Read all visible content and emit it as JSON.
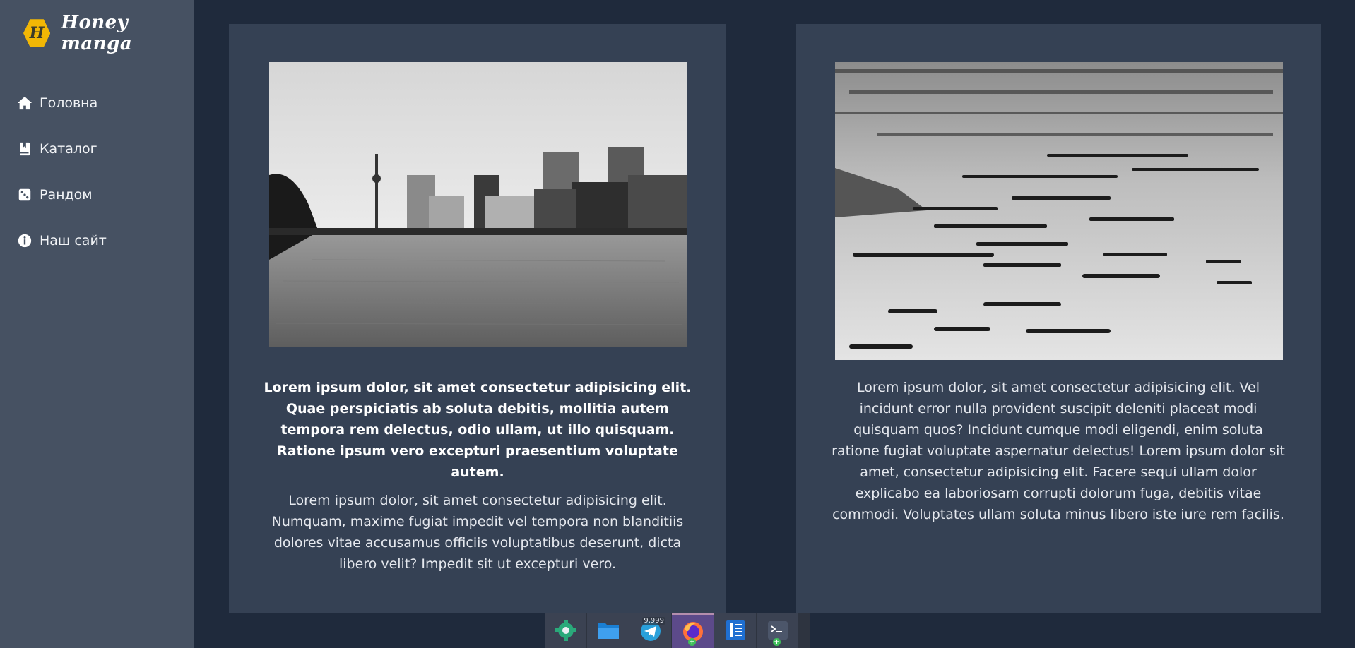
{
  "brand": {
    "logo_letter": "H",
    "name": "Honey manga",
    "logo_color": "#f2b705"
  },
  "sidebar": {
    "items": [
      {
        "label": "Головна",
        "icon": "home-icon"
      },
      {
        "label": "Каталог",
        "icon": "book-icon"
      },
      {
        "label": "Рандом",
        "icon": "dice-icon"
      },
      {
        "label": "Наш сайт",
        "icon": "info-icon"
      }
    ]
  },
  "cards": [
    {
      "image": "black-and-white-photo-city-river-skyline",
      "text_bold": "Lorem ipsum dolor, sit amet consectetur adipisicing elit. Quae perspiciatis ab soluta debitis, mollitia autem tempora rem delectus, odio ullam, ut illo quisquam. Ratione ipsum vero excepturi praesentium voluptate autem.",
      "text": "Lorem ipsum dolor, sit amet consectetur adipisicing elit. Numquam, maxime fugiat impedit vel tempora non blanditiis dolores vitae accusamus officiis voluptatibus deserunt, dicta libero velit? Impedit sit ut excepturi vero."
    },
    {
      "image": "black-and-white-photo-boats-on-water",
      "text": "Lorem ipsum dolor, sit amet consectetur adipisicing elit. Vel incidunt error nulla provident suscipit deleniti placeat modi quisquam quos? Incidunt cumque modi eligendi, enim soluta ratione fugiat voluptate aspernatur delectus! Lorem ipsum dolor sit amet, consectetur adipisicing elit. Facere sequi ullam dolor explicabo ea laboriosam corrupti dolorum fuga, debitis vitae commodi. Voluptates ullam soluta minus libero iste iure rem facilis."
    }
  ],
  "taskbar": {
    "items": [
      {
        "icon": "settings-gear-icon"
      },
      {
        "icon": "folder-icon"
      },
      {
        "icon": "telegram-icon",
        "badge": "9,999"
      },
      {
        "icon": "firefox-icon",
        "active": true
      },
      {
        "icon": "text-editor-icon"
      },
      {
        "icon": "terminal-icon"
      }
    ]
  },
  "colors": {
    "page_bg": "#1f2a3c",
    "sidebar_bg": "#465162",
    "card_bg": "#354154"
  }
}
